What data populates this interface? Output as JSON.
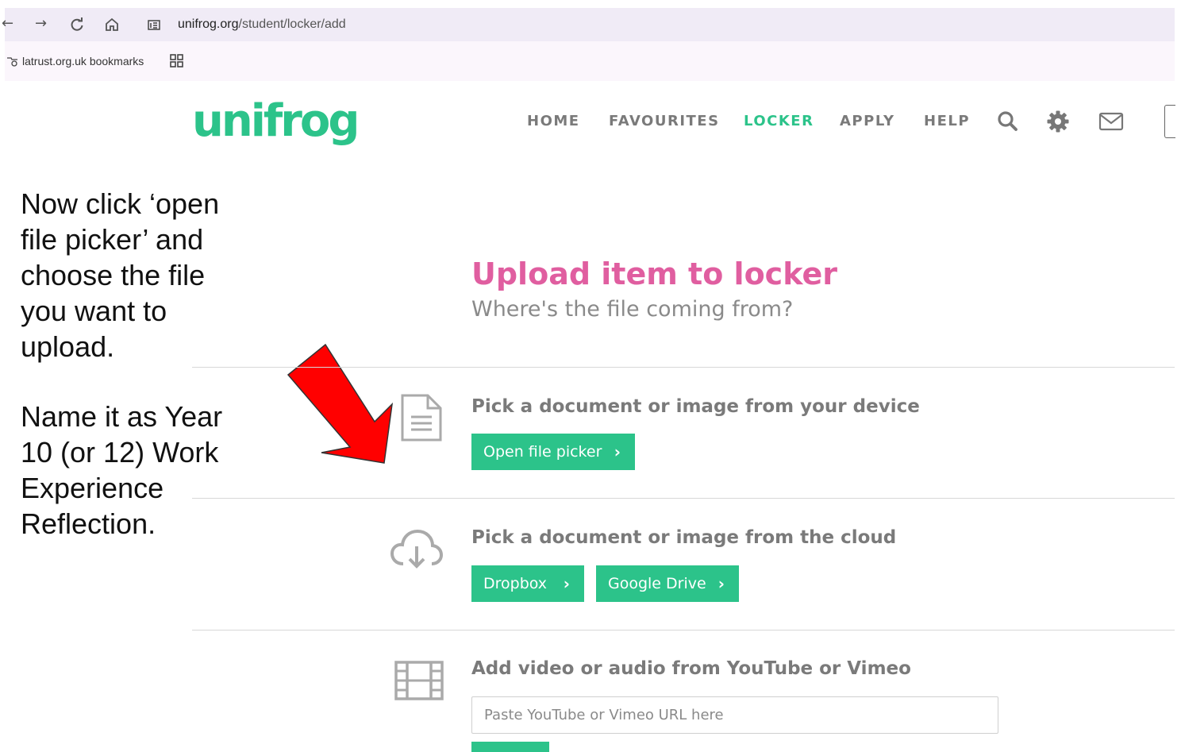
{
  "browser": {
    "url_host": "unifrog.org",
    "url_path": "/student/locker/add",
    "bookmark_label": "latrust.org.uk bookmarks",
    "nav_glyphs": {
      "back": "←",
      "forward": "→",
      "reload": "C",
      "home": "⌂"
    }
  },
  "site": {
    "logo_text": "unifrog",
    "nav": [
      {
        "label": "HOME",
        "active": false
      },
      {
        "label": "FAVOURITES",
        "active": false
      },
      {
        "label": "LOCKER",
        "active": true
      },
      {
        "label": "APPLY",
        "active": false
      },
      {
        "label": "HELP",
        "active": false
      }
    ],
    "icons": [
      "search-icon",
      "gear-icon",
      "mail-icon"
    ],
    "accent_color": "#2cc38a",
    "title_color": "#e05ea0"
  },
  "instructions": {
    "paragraph_1": "Now click ‘open file picker’ and choose the file you want to upload.",
    "paragraph_2": "Name it as Year 10 (or 12) Work Experience Reflection.",
    "arrow_color": "#ff0000"
  },
  "page": {
    "title": "Upload item to locker",
    "subtitle": "Where's the file coming from?"
  },
  "sections": {
    "device": {
      "title": "Pick a document or image from your device",
      "icon": "document-icon",
      "button_label": "Open file picker"
    },
    "cloud": {
      "title": "Pick a document or image from the cloud",
      "icon": "cloud-download-icon",
      "dropbox_label": "Dropbox",
      "gdrive_label": "Google Drive"
    },
    "video": {
      "title": "Add video or audio from YouTube or Vimeo",
      "icon": "film-icon",
      "input_placeholder": "Paste YouTube or Vimeo URL here"
    }
  }
}
